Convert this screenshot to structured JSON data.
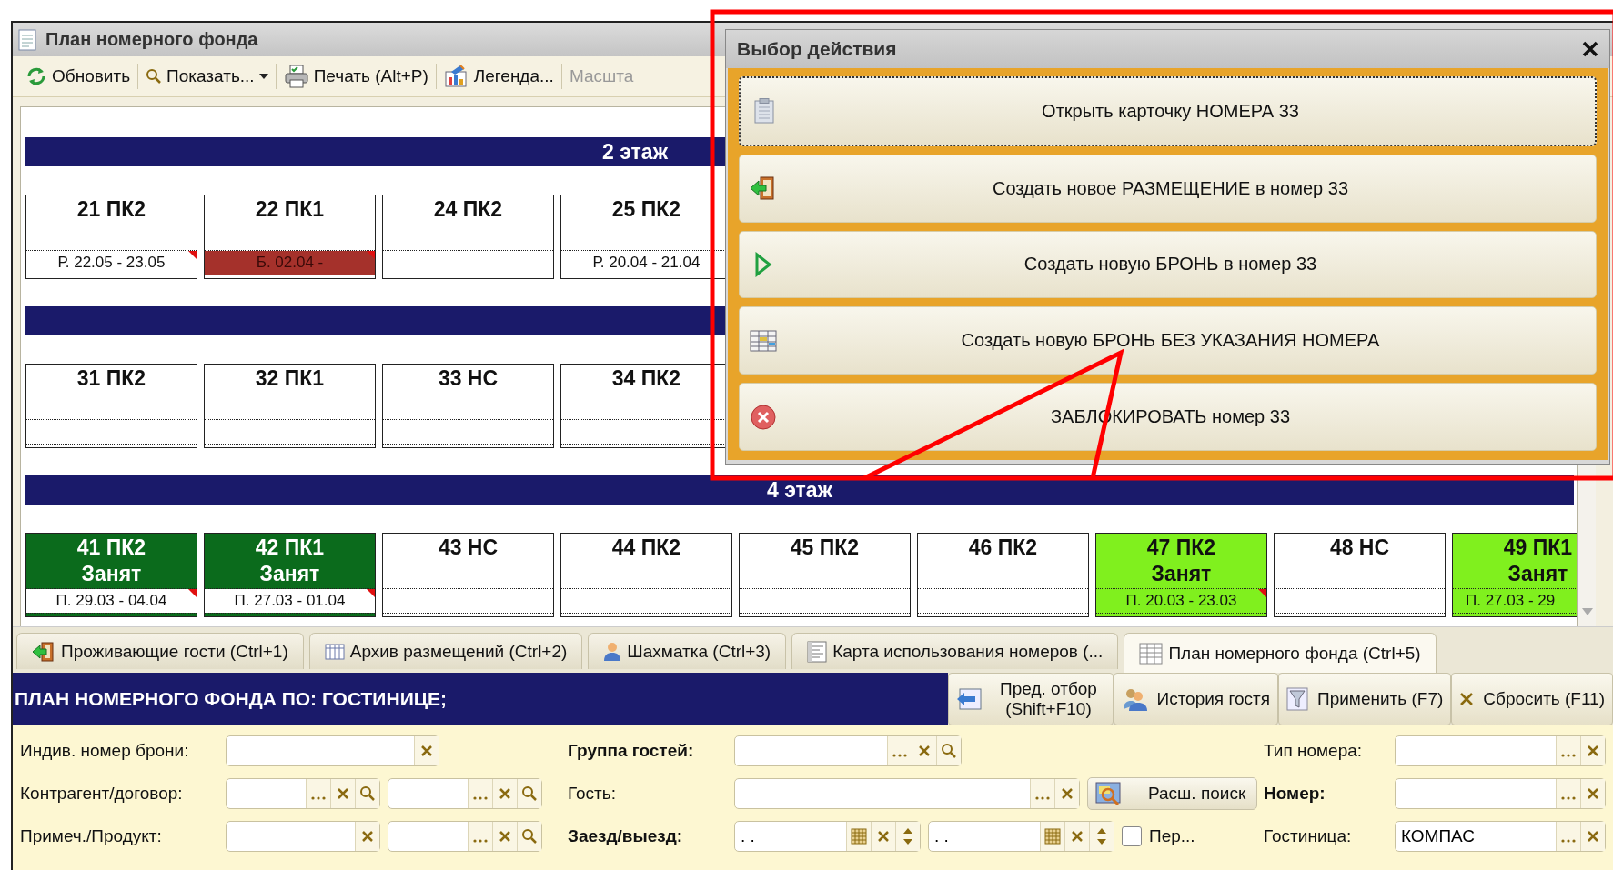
{
  "window": {
    "title": "План номерного фонда"
  },
  "toolbar": [
    {
      "kind": "refresh",
      "label": "Обновить",
      "dropdown": false,
      "disabled": false
    },
    {
      "kind": "show",
      "label": "Показать...",
      "dropdown": true,
      "disabled": false
    },
    {
      "kind": "print",
      "label": "Печать (Alt+P)",
      "dropdown": false,
      "disabled": false
    },
    {
      "kind": "legend",
      "label": "Легенда...",
      "dropdown": false,
      "disabled": false
    },
    {
      "kind": "scale",
      "label": "Масшта",
      "dropdown": false,
      "disabled": true
    }
  ],
  "floors": [
    {
      "label": "2 этаж",
      "rooms": [
        {
          "name": "21 ПК2",
          "color": "#ffffff",
          "bookings": [
            {
              "text": "Р. 22.05 - 23.05",
              "color": "#ffffff",
              "flag": true
            }
          ]
        },
        {
          "name": "22 ПК1",
          "color": "#ffffff",
          "bookings": [
            {
              "text": "Б. 02.04 -",
              "color": "#a5312b",
              "flag": true
            }
          ]
        },
        {
          "name": "24 ПК2",
          "color": "#ffffff"
        },
        {
          "name": "25 ПК2",
          "color": "#ffffff",
          "bookings": [
            {
              "text": "Р. 20.04 - 21.04",
              "color": "#ffffff",
              "flag": false
            }
          ]
        }
      ]
    },
    {
      "rooms": [
        {
          "name": "31 ПК2",
          "color": "#ffffff"
        },
        {
          "name": "32 ПК1",
          "color": "#ffffff"
        },
        {
          "name": "33 НС",
          "color": "#ffffff"
        },
        {
          "name": "34 ПК2",
          "color": "#ffffff"
        }
      ]
    },
    {
      "label": "4 этаж",
      "rooms": [
        {
          "name": "41 ПК2",
          "status": "Занят",
          "color": "#0b6b1c",
          "bookings": [
            {
              "text": "П. 29.03 - 04.04",
              "color": "#ffffff",
              "flag": true
            }
          ]
        },
        {
          "name": "42 ПК1",
          "status": "Занят",
          "color": "#0b6b1c",
          "bookings": [
            {
              "text": "П. 27.03 - 01.04",
              "color": "#ffffff",
              "flag": true
            }
          ]
        },
        {
          "name": "43 НС",
          "color": "#ffffff"
        },
        {
          "name": "44 ПК2",
          "color": "#ffffff"
        },
        {
          "name": "45 ПК2",
          "color": "#ffffff"
        },
        {
          "name": "46 ПК2",
          "color": "#ffffff"
        },
        {
          "name": "47 ПК2",
          "status": "Занят",
          "color": "#80f01e",
          "bookings": [
            {
              "text": "П. 20.03 - 23.03",
              "color": "#80f01e",
              "flag": true
            }
          ]
        },
        {
          "name": "48 НС",
          "color": "#ffffff"
        },
        {
          "name": "49 ПК1",
          "status": "Занят",
          "color": "#80f01e",
          "bookings": [
            {
              "text": "П. 27.03 - 29",
              "color": "#80f01e",
              "flag": false
            }
          ]
        }
      ]
    }
  ],
  "tabs": [
    {
      "kind": "guests",
      "label": "Проживающие гости (Ctrl+1)",
      "selected": false
    },
    {
      "kind": "archive",
      "label": "Архив размещений (Ctrl+2)",
      "selected": false
    },
    {
      "kind": "chess",
      "label": "Шахматка (Ctrl+3)",
      "selected": false
    },
    {
      "kind": "map",
      "label": "Карта использования номеров (...",
      "selected": false
    },
    {
      "kind": "plan",
      "label": "План номерного фонда (Ctrl+5)",
      "selected": true
    }
  ],
  "header": {
    "title": "ПЛАН НОМЕРНОГО ФОНДА ПО: ГОСТИНИЦЕ;",
    "buttons": [
      {
        "kind": "prev",
        "label": "Пред. отбор (Shift+F10)"
      },
      {
        "kind": "history",
        "label": "История гостя"
      },
      {
        "kind": "apply",
        "label": "Применить (F7)"
      },
      {
        "kind": "reset",
        "label": "Сбросить (F11)"
      }
    ]
  },
  "filters": [
    [
      [
        {
          "kind": "label",
          "text": "Индив. номер брони:",
          "bold": false
        },
        {
          "kind": "text"
        }
      ],
      [
        {
          "kind": "label",
          "text": "Группа гостей:",
          "bold": true
        },
        {
          "kind": "ref-search"
        }
      ],
      [
        {
          "kind": "label",
          "text": "Тип номера:",
          "bold": false
        },
        {
          "kind": "ref"
        }
      ]
    ],
    [
      [
        {
          "kind": "label",
          "text": "Контрагент/договор:",
          "bold": false
        },
        {
          "kind": "ref-search"
        },
        {
          "kind": "ref-search"
        }
      ],
      [
        {
          "kind": "label",
          "text": "Гость:",
          "bold": false
        },
        {
          "kind": "ref"
        },
        {
          "kind": "button",
          "text": "Расш. поиск"
        }
      ],
      [
        {
          "kind": "label",
          "text": "Номер:",
          "bold": true
        },
        {
          "kind": "ref"
        }
      ]
    ],
    [
      [
        {
          "kind": "label",
          "text": "Примеч./Продукт:",
          "bold": false
        },
        {
          "kind": "text"
        },
        {
          "kind": "ref-search"
        }
      ],
      [
        {
          "kind": "label",
          "text": "Заезд/выезд:",
          "bold": true
        },
        {
          "kind": "date",
          "value": ". ."
        },
        {
          "kind": "date",
          "value": ". ."
        },
        {
          "kind": "checkbox",
          "text": "Пер...",
          "checked": false
        }
      ],
      [
        {
          "kind": "label",
          "text": "Гостиница:",
          "bold": false
        },
        {
          "kind": "ref",
          "value": "КОМПАС"
        }
      ]
    ]
  ],
  "dialog": {
    "title": "Выбор действия",
    "actions": [
      {
        "kind": "card",
        "label": "Открыть карточку НОМЕРА 33",
        "focused": true
      },
      {
        "kind": "checkin",
        "label": "Создать новое РАЗМЕЩЕНИЕ в номер 33",
        "focused": false
      },
      {
        "kind": "booking",
        "label": "Создать новую БРОНЬ в номер 33",
        "focused": false
      },
      {
        "kind": "booking-free",
        "label": "Создать новую БРОНЬ БЕЗ УКАЗАНИЯ НОМЕРА",
        "focused": false
      },
      {
        "kind": "block",
        "label": "ЗАБЛОКИРОВАТЬ номер 33",
        "focused": false
      }
    ]
  }
}
